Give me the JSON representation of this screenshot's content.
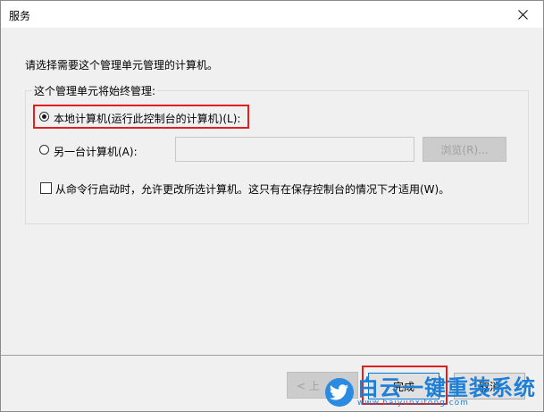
{
  "window": {
    "title": "服务"
  },
  "instruction": "请选择需要这个管理单元管理的计算机。",
  "group": {
    "legend": "这个管理单元将始终管理:",
    "local_option_label": "本地计算机(运行此控制台的计算机)(L):",
    "local_selected": true,
    "remote_option_label": "另一台计算机(A):",
    "remote_selected": false,
    "remote_computer_value": "",
    "browse_label": "浏览(R)...",
    "checkbox_label": "从命令行启动时，允许更改所选计算机。这只有在保存控制台的情况下才适用(W)。",
    "checkbox_checked": false
  },
  "footer": {
    "back_label": "< 上",
    "finish_label": "完成",
    "cancel_label": "取消"
  },
  "watermark": {
    "text": "白云一键重装系统",
    "url": "www.baiyunxitong.com"
  },
  "colors": {
    "highlight": "#e02020",
    "watermark": "#1d7fd6"
  }
}
